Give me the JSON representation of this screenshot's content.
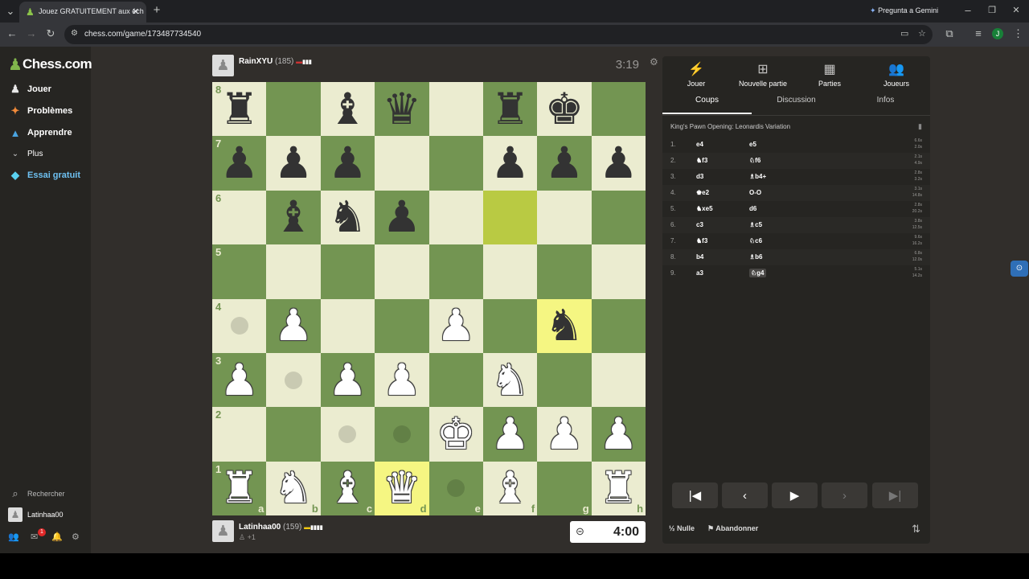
{
  "browser": {
    "tab_title": "Jouez GRATUITEMENT aux éch",
    "url": "chess.com/game/173487734540",
    "gemini": "Pregunta a Gemini",
    "profile_initial": "J"
  },
  "sidebar": {
    "logo": "Chess.com",
    "items": [
      {
        "label": "Jouer",
        "icon": "pawn-icon"
      },
      {
        "label": "Problèmes",
        "icon": "puzzle-icon"
      },
      {
        "label": "Apprendre",
        "icon": "learn-icon"
      },
      {
        "label": "Plus",
        "icon": "chevron-down-icon"
      },
      {
        "label": "Essai gratuit",
        "icon": "diamond-icon"
      }
    ],
    "search": "Rechercher",
    "user": "Latinhaa00",
    "badge": "1"
  },
  "top_player": {
    "name": "RainXYU",
    "rating": "(185)",
    "clock": "3:19"
  },
  "bottom_player": {
    "name": "Latinhaa00",
    "rating": "(159)",
    "material": "+1",
    "clock": "4:00"
  },
  "board": {
    "ranks": [
      "8",
      "7",
      "6",
      "5",
      "4",
      "3",
      "2",
      "1"
    ],
    "files": [
      "a",
      "b",
      "c",
      "d",
      "e",
      "f",
      "g",
      "h"
    ],
    "pieces": [
      [
        "r",
        "",
        "b",
        "q",
        "",
        "r",
        "k",
        ""
      ],
      [
        "p",
        "p",
        "p",
        "",
        "",
        "p",
        "p",
        "p"
      ],
      [
        "",
        "b",
        "n",
        "p",
        "",
        "",
        "",
        ""
      ],
      [
        "",
        "",
        "",
        "",
        "",
        "",
        "",
        ""
      ],
      [
        "",
        "P",
        "",
        "",
        "P",
        "",
        "n",
        ""
      ],
      [
        "P",
        "",
        "P",
        "P",
        "",
        "N",
        "",
        ""
      ],
      [
        "",
        "",
        "",
        "",
        "K",
        "P",
        "P",
        "P"
      ],
      [
        "R",
        "N",
        "B",
        "Q",
        "",
        "B",
        "",
        "R"
      ]
    ],
    "highlights": [
      [
        2,
        5
      ],
      [
        4,
        6
      ],
      [
        7,
        3
      ]
    ],
    "dots": [
      [
        4,
        0
      ],
      [
        5,
        1
      ],
      [
        6,
        2
      ],
      [
        6,
        3
      ],
      [
        7,
        4
      ]
    ]
  },
  "panel": {
    "topnav": [
      "Jouer",
      "Nouvelle partie",
      "Parties",
      "Joueurs"
    ],
    "subtabs": [
      "Coups",
      "Discussion",
      "Infos"
    ],
    "opening": "King's Pawn Opening: Leonardis Variation",
    "moves": [
      {
        "n": "1.",
        "w": "e4",
        "b": "e5",
        "t1": "6.6s",
        "t2": "2.0s"
      },
      {
        "n": "2.",
        "w": "♞f3",
        "b": "♘f6",
        "t1": "2.1s",
        "t2": "4.9s"
      },
      {
        "n": "3.",
        "w": "d3",
        "b": "♗b4+",
        "t1": "2.8s",
        "t2": "3.2s"
      },
      {
        "n": "4.",
        "w": "♚e2",
        "b": "O-O",
        "t1": "3.1s",
        "t2": "14.8s"
      },
      {
        "n": "5.",
        "w": "♞xe5",
        "b": "d6",
        "t1": "2.8s",
        "t2": "20.2s"
      },
      {
        "n": "6.",
        "w": "c3",
        "b": "♗c5",
        "t1": "3.8s",
        "t2": "12.5s"
      },
      {
        "n": "7.",
        "w": "♞f3",
        "b": "♘c6",
        "t1": "9.6s",
        "t2": "16.2s"
      },
      {
        "n": "8.",
        "w": "b4",
        "b": "♗b6",
        "t1": "6.8s",
        "t2": "12.0s"
      },
      {
        "n": "9.",
        "w": "a3",
        "b": "♘g4",
        "t1": "5.1s",
        "t2": "14.2s"
      }
    ],
    "draw": "Nulle",
    "resign": "Abandonner"
  }
}
